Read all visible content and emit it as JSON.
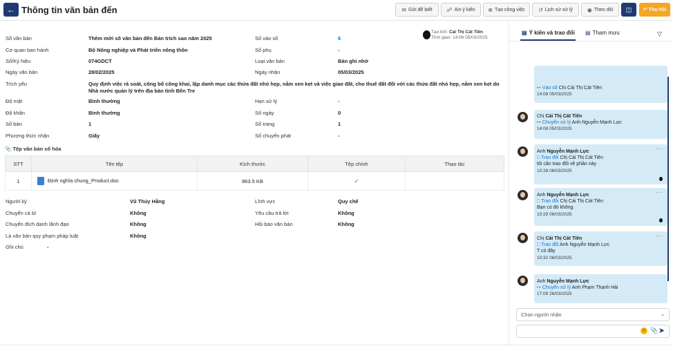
{
  "header": {
    "title": "Thông tin văn bản đến",
    "buttons": [
      "Gửi để biết",
      "Xin ý kiến",
      "Tạo công việc",
      "Lịch sử xử lý",
      "Theo dõi"
    ],
    "recall_label": "Thu hồi"
  },
  "creator": {
    "label": "Tạo bởi:",
    "name": "Cái Thị Cát Tiên",
    "time_label": "Thời gian:",
    "time": "14:08 05/03/2025"
  },
  "info": [
    {
      "label": "Số văn bản",
      "value": "Thêm mới số văn bản đến Bản trích sao năm 2025"
    },
    {
      "label": "Số vào sổ",
      "value": "6"
    },
    {
      "label": "Cơ quan ban hành",
      "value": "Bộ Nông nghiệp và Phát triển nông thôn"
    },
    {
      "label": "Số phụ",
      "value": "-"
    },
    {
      "label": "Số/Ký hiệu",
      "value": "074GDCT"
    },
    {
      "label": "Loại văn bản",
      "value": "Bản ghi nhớ"
    },
    {
      "label": "Ngày văn bản",
      "value": "28/02/2025"
    },
    {
      "label": "Ngày nhận",
      "value": "05/03/2025"
    },
    {
      "label": "Trích yếu",
      "value": "Quy định việc rà soát, công bố công khai, lập danh mục các thửa đất nhỏ hẹp, nằm xen kẹt và việc giao đất, cho thuê đất đối với các thửa đất nhỏ hẹp, nằm xen kẹt do Nhà nước quản lý trên địa bàn tỉnh Bến Tre"
    },
    {
      "label": "Độ mật",
      "value": "Bình thường"
    },
    {
      "label": "Hạn xử lý",
      "value": "-"
    },
    {
      "label": "Độ khẩn",
      "value": "Bình thường"
    },
    {
      "label": "Số ngày",
      "value": "0"
    },
    {
      "label": "Số bản",
      "value": "1"
    },
    {
      "label": "Số trang",
      "value": "1"
    },
    {
      "label": "Phương thức nhận",
      "value": "Giấy"
    },
    {
      "label": "Số chuyển phát",
      "value": "-"
    }
  ],
  "files": {
    "section_title": "Tệp văn bản số hóa",
    "columns": [
      "STT",
      "Tên tệp",
      "Kích thước",
      "Tệp chính",
      "Thao tác"
    ],
    "rows": [
      {
        "stt": "1",
        "name": "Định nghĩa chung_Product.doc",
        "size": "863.5 KB",
        "main": "✓",
        "actions": ""
      }
    ]
  },
  "extra": [
    {
      "label": "Người ký",
      "value": "Vũ Thúy Hằng"
    },
    {
      "label": "Lĩnh vực",
      "value": "Quy chế"
    },
    {
      "label": "Chuyển cá bì",
      "value": "Không"
    },
    {
      "label": "Yêu cầu trả lời",
      "value": "Không"
    },
    {
      "label": "Chuyển đích danh lãnh đạo",
      "value": "Không"
    },
    {
      "label": "Hồi báo văn bản",
      "value": "Không"
    },
    {
      "label": "Là văn bản quy phạm pháp luật",
      "value": "Không"
    },
    {
      "label": "Ghi chú",
      "value": "-"
    }
  ],
  "right_panel": {
    "tabs": [
      "Ý kiến và trao đổi",
      "Tham mưu"
    ],
    "messages": [
      {
        "who": "",
        "action": "Vào sổ",
        "target_prefix": "Chị",
        "target": "Cái Thị Cát Tiên",
        "text": "",
        "time": "14:08 05/03/2025"
      },
      {
        "who_prefix": "Chị",
        "who": "Cái Thị Cát Tiên",
        "action": "Chuyển xử lý",
        "target_prefix": "Anh",
        "target": "Nguyễn Mạnh Lực",
        "text": "",
        "time": "14:08 05/03/2025"
      },
      {
        "who_prefix": "Anh",
        "who": "Nguyễn Mạnh Lực",
        "action": "Trao đổi",
        "target_prefix": "Chị",
        "target": "Cái Thị Cát Tiên",
        "text": "tôi cần trao đổi về phần này",
        "time": "10:28 06/03/2025"
      },
      {
        "who_prefix": "Anh",
        "who": "Nguyễn Mạnh Lực",
        "action": "Trao đổi",
        "target_prefix": "Chị",
        "target": "Cái Thị Cát Tiên",
        "text": "Bạn có đó không",
        "time": "10:29 06/03/2025"
      },
      {
        "who_prefix": "Chị",
        "who": "Cái Thị Cát Tiên",
        "action": "Trao đổi",
        "target_prefix": "Anh",
        "target": "Nguyễn Mạnh Lực",
        "text": "T có đây",
        "time": "10:32 06/03/2025"
      },
      {
        "who_prefix": "Anh",
        "who": "Nguyễn Mạnh Lực",
        "action": "Chuyển xử lý",
        "target_prefix": "Anh",
        "target": "Phạm Thanh Hải",
        "text": "",
        "time": "17:09 26/03/2025"
      }
    ],
    "select_placeholder": "Chọn người nhận"
  }
}
